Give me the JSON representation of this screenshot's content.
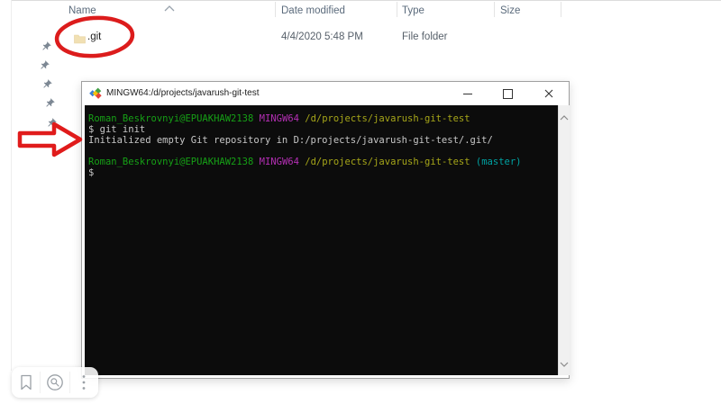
{
  "explorer": {
    "columns": [
      {
        "label": "Name"
      },
      {
        "label": "Date modified"
      },
      {
        "label": "Type"
      },
      {
        "label": "Size"
      }
    ],
    "sort_icon": "chevron-up-icon",
    "row": {
      "icon": "folder-icon",
      "name": ".git",
      "date_modified": "4/4/2020 5:48 PM",
      "type": "File folder",
      "size": ""
    }
  },
  "pins": {
    "icon": "pushpin-icon",
    "count": 6,
    "color": "#7d8894"
  },
  "terminal": {
    "app_icon": "git-bash-icon",
    "title": "MINGW64:/d/projects/javarush-git-test",
    "window_controls": [
      {
        "name": "minimize"
      },
      {
        "name": "maximize"
      },
      {
        "name": "close"
      }
    ],
    "colors": {
      "green": "#16a016",
      "magenta": "#b52fb5",
      "yellow": "#a6a619",
      "cyan": "#00a2a2",
      "default": "#c7c7c7",
      "background": "#0c0c0c"
    },
    "lines": [
      [
        {
          "t": "Roman_Beskrovnyi@EPUAKHAW2138",
          "c": "green"
        },
        {
          "t": " ",
          "c": "default"
        },
        {
          "t": "MINGW64",
          "c": "magenta"
        },
        {
          "t": " ",
          "c": "default"
        },
        {
          "t": "/d/projects/javarush-git-test",
          "c": "yellow"
        }
      ],
      [
        {
          "t": "$ git init",
          "c": "default"
        }
      ],
      [
        {
          "t": "Initialized empty Git repository in D:/projects/javarush-git-test/.git/",
          "c": "default"
        }
      ],
      [],
      [
        {
          "t": "Roman_Beskrovnyi@EPUAKHAW2138",
          "c": "green"
        },
        {
          "t": " ",
          "c": "default"
        },
        {
          "t": "MINGW64",
          "c": "magenta"
        },
        {
          "t": " ",
          "c": "default"
        },
        {
          "t": "/d/projects/javarush-git-test",
          "c": "yellow"
        },
        {
          "t": " ",
          "c": "default"
        },
        {
          "t": "(master)",
          "c": "cyan"
        }
      ],
      [
        {
          "t": "$",
          "c": "default"
        }
      ]
    ],
    "scrollbar": {
      "up_icon": "chevron-up-icon",
      "down_icon": "chevron-down-icon"
    }
  },
  "annotations": {
    "ellipse_color": "#dc1c1c",
    "arrow_color": "#e01b1b"
  },
  "overlay_toolbar": {
    "items": [
      {
        "icon": "bookmark-icon"
      },
      {
        "icon": "image-search-icon"
      },
      {
        "icon": "kebab-menu-icon"
      }
    ]
  }
}
